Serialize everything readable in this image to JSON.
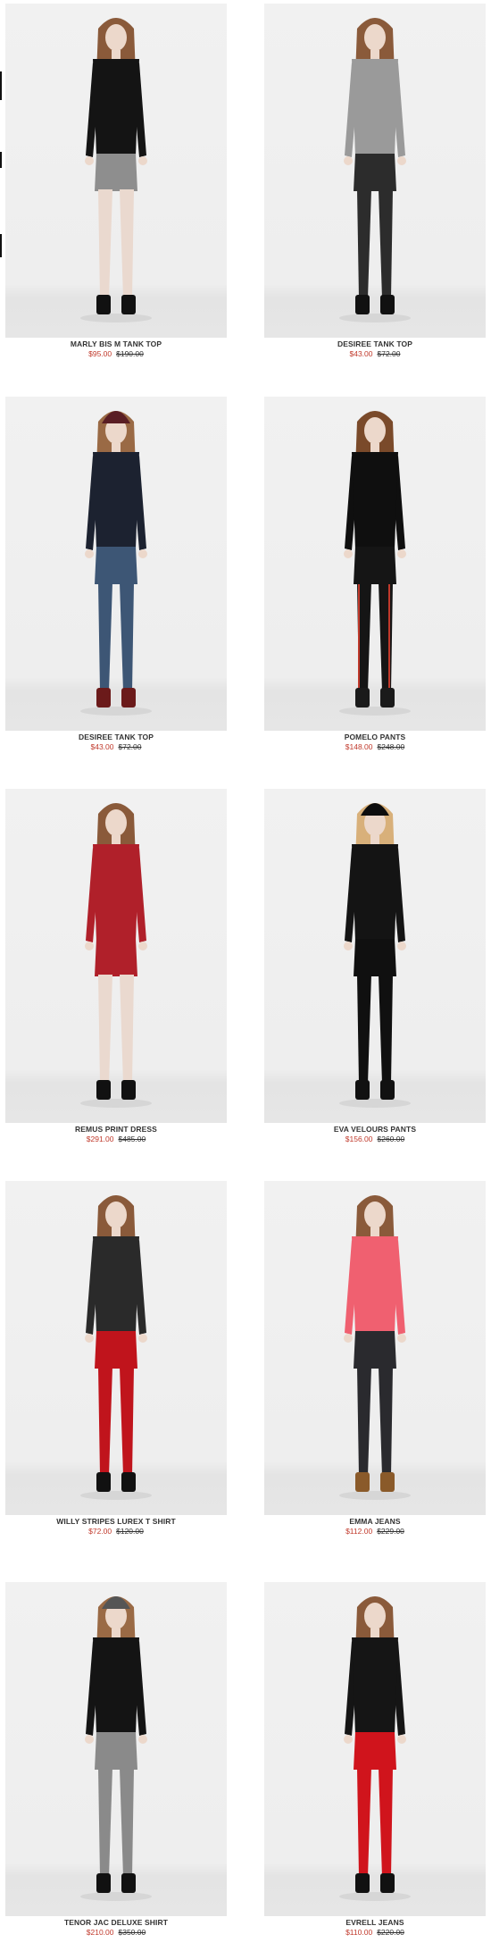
{
  "products": [
    {
      "name": "MARLY BIS M TANK TOP",
      "price": "$95.00",
      "original_price": "$190.00",
      "outfit": {
        "top": "#141414",
        "bottom": "#8e8e8e",
        "legs": "#ead9cf",
        "hair": "#8a5a3a",
        "shoes": "#111111",
        "hat": ""
      }
    },
    {
      "name": "DESIREE TANK TOP",
      "price": "$43.00",
      "original_price": "$72.00",
      "outfit": {
        "top": "#9a9a9a",
        "bottom": "#2c2c2c",
        "legs": "#2c2c2c",
        "hair": "#8a5a3a",
        "shoes": "#111111",
        "hat": ""
      }
    },
    {
      "name": "DESIREE TANK TOP",
      "price": "$43.00",
      "original_price": "$72.00",
      "outfit": {
        "top": "#1c2230",
        "bottom": "#3d5675",
        "legs": "#3d5675",
        "hair": "#9a6a45",
        "shoes": "#6b1a1a",
        "hat": "#5a1e24"
      }
    },
    {
      "name": "POMELO PANTS",
      "price": "$148.00",
      "original_price": "$248.00",
      "outfit": {
        "top": "#0f0f0f",
        "bottom": "#151515",
        "legs": "#151515",
        "hair": "#7a4a2a",
        "shoes": "#1a1a1a",
        "hat": "",
        "stripe": "#c0392b"
      }
    },
    {
      "name": "REMUS PRINT DRESS",
      "price": "$291.00",
      "original_price": "$485.00",
      "outfit": {
        "top": "#b0202a",
        "bottom": "#b0202a",
        "legs": "#ead9cf",
        "hair": "#8a5a3a",
        "shoes": "#111111",
        "hat": ""
      }
    },
    {
      "name": "EVA VELOURS PANTS",
      "price": "$156.00",
      "original_price": "$260.00",
      "outfit": {
        "top": "#141414",
        "bottom": "#101010",
        "legs": "#101010",
        "hair": "#d8b07a",
        "shoes": "#111111",
        "hat": "#0d0d0d"
      }
    },
    {
      "name": "WILLY STRIPES LUREX T SHIRT",
      "price": "$72.00",
      "original_price": "$120.00",
      "outfit": {
        "top": "#2a2a2a",
        "bottom": "#c0141c",
        "legs": "#c0141c",
        "hair": "#8a5a3a",
        "shoes": "#111111",
        "hat": ""
      }
    },
    {
      "name": "EMMA JEANS",
      "price": "$112.00",
      "original_price": "$229.00",
      "outfit": {
        "top": "#f06070",
        "bottom": "#2a2a2e",
        "legs": "#2a2a2e",
        "hair": "#8a5a3a",
        "shoes": "#8a5a2a",
        "hat": ""
      }
    },
    {
      "name": "TENOR JAC DELUXE SHIRT",
      "price": "$210.00",
      "original_price": "$350.00",
      "outfit": {
        "top": "#141414",
        "bottom": "#8a8a8a",
        "legs": "#8a8a8a",
        "hair": "#9a6a45",
        "shoes": "#111111",
        "hat": "#555555"
      }
    },
    {
      "name": "EVRELL JEANS",
      "price": "$110.00",
      "original_price": "$220.00",
      "outfit": {
        "top": "#151515",
        "bottom": "#d0141c",
        "legs": "#d0141c",
        "hair": "#8a5a3a",
        "shoes": "#111111",
        "hat": ""
      }
    }
  ],
  "colors": {
    "sale_price": "#c0392b",
    "original_price": "#333333",
    "title": "#333333",
    "photo_background": "#eeeeee"
  }
}
